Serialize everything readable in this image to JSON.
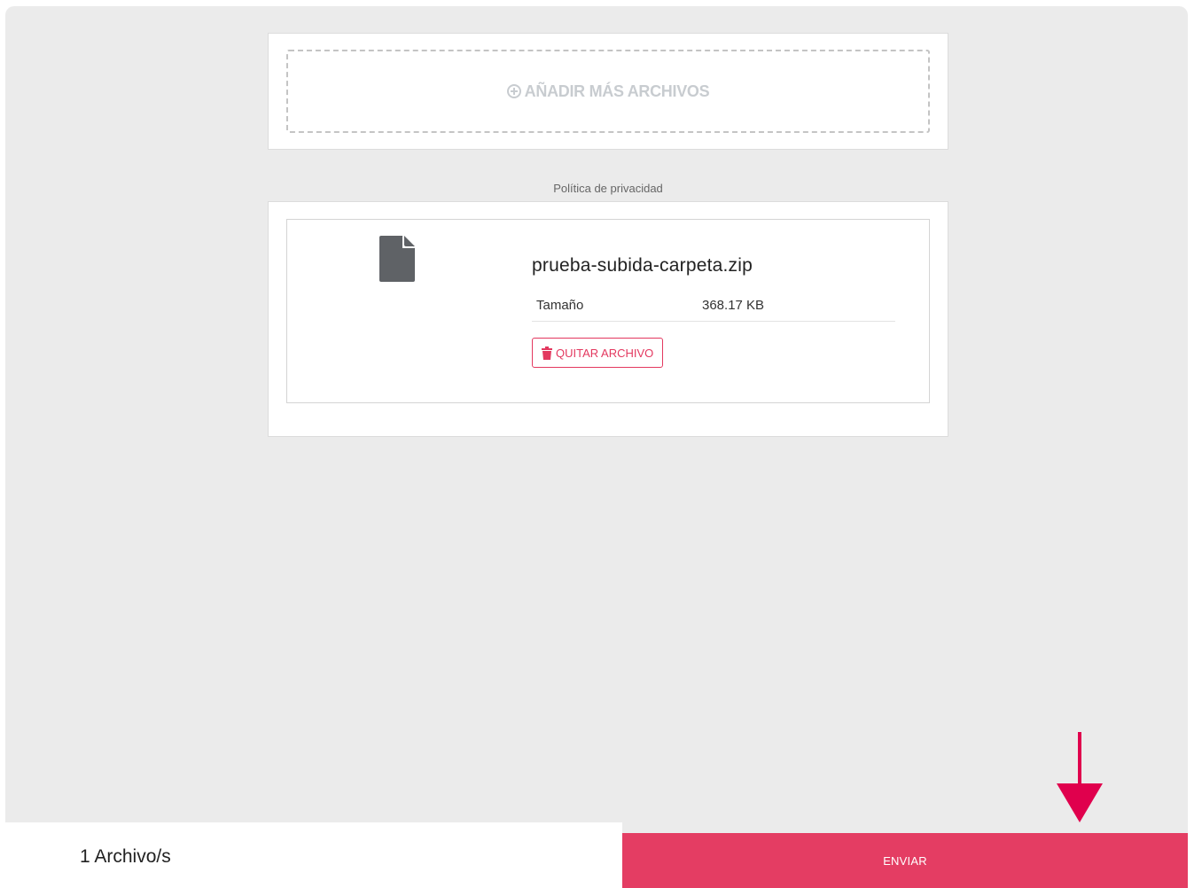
{
  "upload": {
    "add_more_label": "AÑADIR MÁS ARCHIVOS"
  },
  "privacy_link": "Política de privacidad",
  "file": {
    "name": "prueba-subida-carpeta.zip",
    "size_label": "Tamaño",
    "size_value": "368.17 KB",
    "remove_label": "QUITAR ARCHIVO"
  },
  "footer": {
    "count_text": "1 Archivo/s",
    "send_label": "ENVIAR"
  },
  "colors": {
    "accent": "#e43d63",
    "background": "#ebebeb",
    "icon_gray": "#5f6266"
  },
  "icons": [
    "plus-circle-icon",
    "file-icon",
    "trash-icon",
    "arrow-down-icon"
  ]
}
